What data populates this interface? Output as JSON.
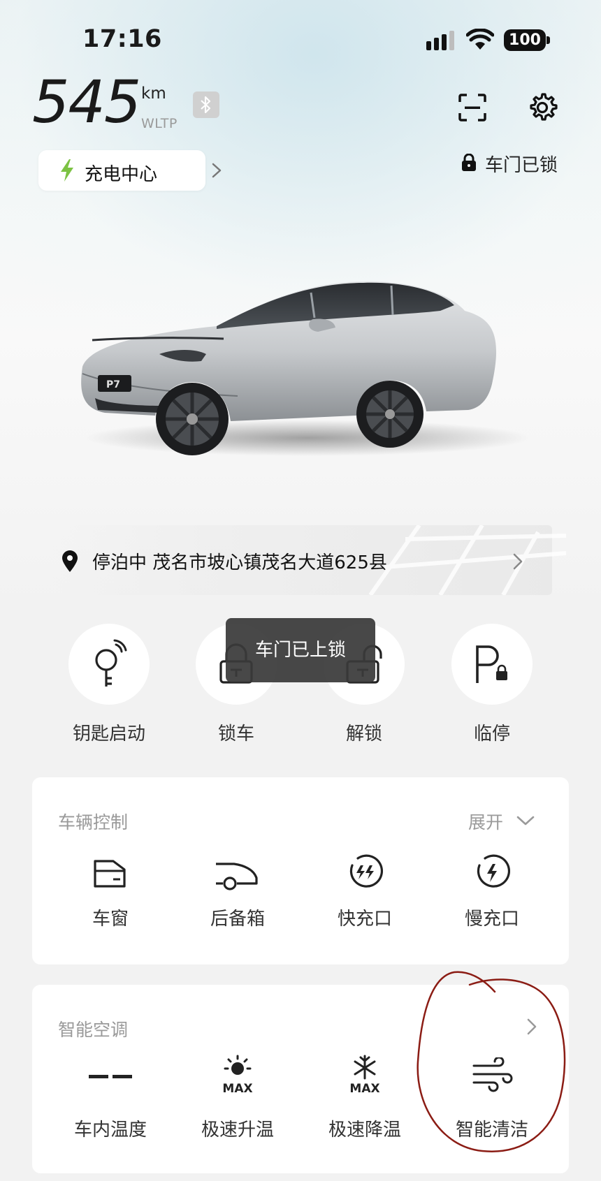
{
  "status_bar": {
    "time": "17:16",
    "battery": "100",
    "icons": [
      "signal-icon",
      "wifi-icon",
      "battery-icon"
    ]
  },
  "range": {
    "value": "545",
    "unit": "km",
    "standard": "WLTP"
  },
  "charge_center": {
    "label": "充电中心"
  },
  "lock_status": "车门已锁",
  "location": {
    "label": "停泊中 茂名市坡心镇茂名大道625县"
  },
  "quick_actions": [
    {
      "label": "钥匙启动",
      "icon": "key-icon"
    },
    {
      "label": "锁车",
      "icon": "lock-icon"
    },
    {
      "label": "解锁",
      "icon": "unlock-icon"
    },
    {
      "label": "临停",
      "icon": "temporary-parking-icon"
    }
  ],
  "toast": "车门已上锁",
  "vehicle_control": {
    "title": "车辆控制",
    "expand_label": "展开",
    "items": [
      {
        "label": "车窗",
        "icon": "window-icon"
      },
      {
        "label": "后备箱",
        "icon": "trunk-icon"
      },
      {
        "label": "快充口",
        "icon": "fast-charge-port-icon"
      },
      {
        "label": "慢充口",
        "icon": "slow-charge-port-icon"
      }
    ]
  },
  "climate": {
    "title": "智能空调",
    "items": [
      {
        "label": "车内温度",
        "icon": "cabin-temperature-icon"
      },
      {
        "label": "极速升温",
        "icon": "max-heat-icon",
        "badge": "MAX"
      },
      {
        "label": "极速降温",
        "icon": "max-cool-icon",
        "badge": "MAX"
      },
      {
        "label": "智能清洁",
        "icon": "smart-clean-icon"
      }
    ]
  },
  "vehicle_badge": "P7",
  "colors": {
    "background": "#f2f2f2",
    "card": "#ffffff",
    "charge_bolt": "#7cc243",
    "annotation": "#8b1c14",
    "toast": "#3a3a3a"
  }
}
